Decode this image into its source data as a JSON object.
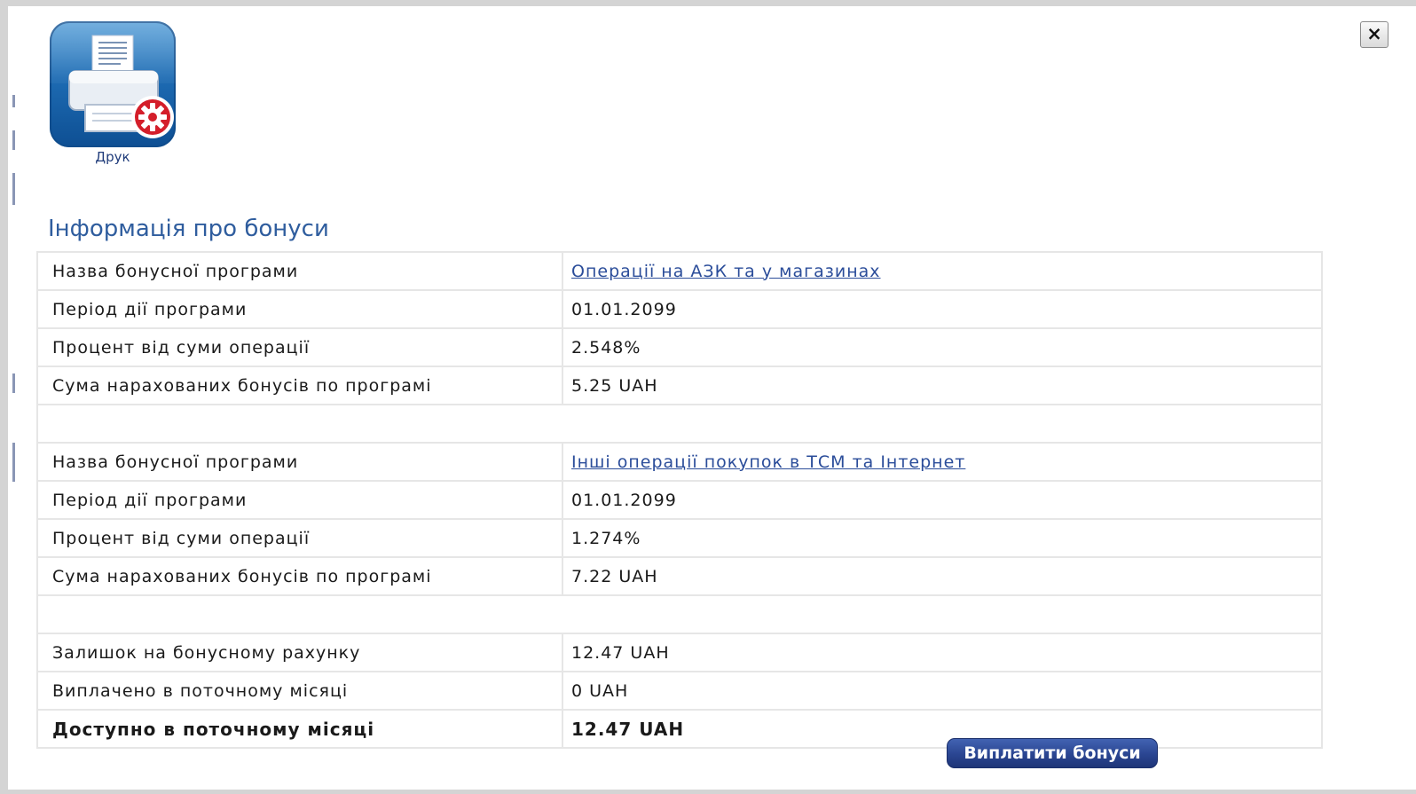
{
  "toolbar": {
    "close_symbol": "×",
    "print_label": "Друк",
    "print_icon": "printer-settings-icon"
  },
  "section_title": "Інформація про бонуси",
  "programs": [
    {
      "name_label": "Назва бонусної програми",
      "name_value": "Операції на АЗК та у магазинах",
      "period_label": "Період дії програми",
      "period_value": "01.01.2099",
      "percent_label": "Процент від суми операції",
      "percent_value": "2.548%",
      "sum_label": "Сума нарахованих бонусів по програмі",
      "sum_value": "5.25 UAH"
    },
    {
      "name_label": "Назва бонусної програми",
      "name_value": "Інші операції покупок в ТСМ та Інтернет",
      "period_label": "Період дії програми",
      "period_value": "01.01.2099",
      "percent_label": "Процент від суми операції",
      "percent_value": "1.274%",
      "sum_label": "Сума нарахованих бонусів по програмі",
      "sum_value": "7.22 UAH"
    }
  ],
  "summary": {
    "balance_label": "Залишок на бонусному рахунку",
    "balance_value": "12.47 UAH",
    "paid_label": "Виплачено в поточному місяці",
    "paid_value": "0 UAH",
    "available_label": "Доступно в поточному місяці",
    "available_value": "12.47 UAH",
    "pay_button_label": "Виплатити бонуси"
  },
  "colors": {
    "link": "#2b4d9a",
    "title": "#2f5d9e",
    "button": "#2a4591",
    "border": "#e6e6e6"
  }
}
